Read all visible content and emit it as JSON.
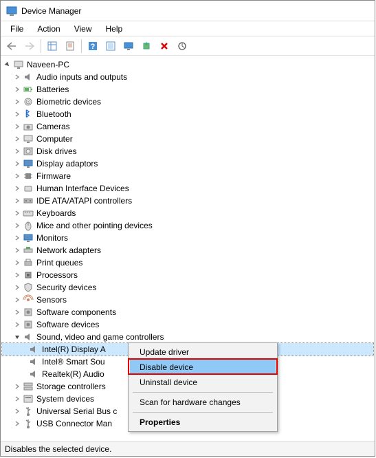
{
  "window": {
    "title": "Device Manager"
  },
  "menu": {
    "file": "File",
    "action": "Action",
    "view": "View",
    "help": "Help"
  },
  "root": {
    "name": "Naveen-PC"
  },
  "categories": [
    {
      "label": "Audio inputs and outputs",
      "icon": "speaker"
    },
    {
      "label": "Batteries",
      "icon": "battery"
    },
    {
      "label": "Biometric devices",
      "icon": "fingerprint"
    },
    {
      "label": "Bluetooth",
      "icon": "bluetooth"
    },
    {
      "label": "Cameras",
      "icon": "camera"
    },
    {
      "label": "Computer",
      "icon": "computer"
    },
    {
      "label": "Disk drives",
      "icon": "disk"
    },
    {
      "label": "Display adaptors",
      "icon": "display"
    },
    {
      "label": "Firmware",
      "icon": "chip"
    },
    {
      "label": "Human Interface Devices",
      "icon": "hid"
    },
    {
      "label": "IDE ATA/ATAPI controllers",
      "icon": "ide"
    },
    {
      "label": "Keyboards",
      "icon": "keyboard"
    },
    {
      "label": "Mice and other pointing devices",
      "icon": "mouse"
    },
    {
      "label": "Monitors",
      "icon": "monitor"
    },
    {
      "label": "Network adapters",
      "icon": "network"
    },
    {
      "label": "Print queues",
      "icon": "printer"
    },
    {
      "label": "Processors",
      "icon": "cpu"
    },
    {
      "label": "Security devices",
      "icon": "security"
    },
    {
      "label": "Sensors",
      "icon": "sensor"
    },
    {
      "label": "Software components",
      "icon": "software"
    },
    {
      "label": "Software devices",
      "icon": "software"
    }
  ],
  "expanded_category": {
    "label": "Sound, video and game controllers",
    "icon": "speaker",
    "children": [
      {
        "label": "Intel(R) Display A",
        "selected": true
      },
      {
        "label": "Intel® Smart Sou",
        "selected": false
      },
      {
        "label": "Realtek(R) Audio",
        "selected": false
      }
    ]
  },
  "categories_after": [
    {
      "label": "Storage controllers",
      "icon": "storage"
    },
    {
      "label": "System devices",
      "icon": "system"
    },
    {
      "label": "Universal Serial Bus c",
      "icon": "usb"
    },
    {
      "label": "USB Connector Man",
      "icon": "usb"
    }
  ],
  "context_menu": {
    "update": "Update driver",
    "disable": "Disable device",
    "uninstall": "Uninstall device",
    "scan": "Scan for hardware changes",
    "properties": "Properties"
  },
  "status": "Disables the selected device.",
  "icons": {
    "back": "back-icon",
    "forward": "forward-icon",
    "view_options": "view-options-icon",
    "properties": "properties-icon",
    "help": "help-icon",
    "refresh": "refresh-icon",
    "monitor_tb": "monitor-toolbar-icon",
    "install": "install-icon",
    "remove": "remove-icon",
    "scan": "scan-icon"
  }
}
